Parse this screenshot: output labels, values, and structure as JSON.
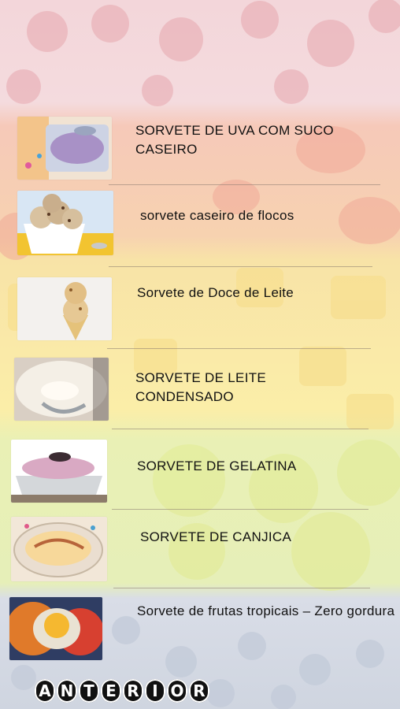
{
  "items": [
    {
      "title": "SORVETE DE UVA COM SUCO CASEIRO"
    },
    {
      "title": "sorvete caseiro de flocos"
    },
    {
      "title": "Sorvete de Doce de Leite"
    },
    {
      "title": "SORVETE DE LEITE CONDENSADO"
    },
    {
      "title": "SORVETE DE GELATINA"
    },
    {
      "title": "SORVETE DE CANJICA"
    },
    {
      "title": "Sorvete de frutas tropicais – Zero gordura"
    }
  ],
  "footer": {
    "prev_label": "ANTERIOR"
  },
  "icons": {
    "thumb_1": "grape-ice-cream-photo",
    "thumb_2": "flakes-ice-cream-photo",
    "thumb_3": "dulce-de-leche-cone-photo",
    "thumb_4": "condensed-milk-ice-cream-photo",
    "thumb_5": "gelatin-ice-cream-photo",
    "thumb_6": "canjica-ice-cream-photo",
    "thumb_7": "tropical-fruit-ice-cream-photo"
  }
}
